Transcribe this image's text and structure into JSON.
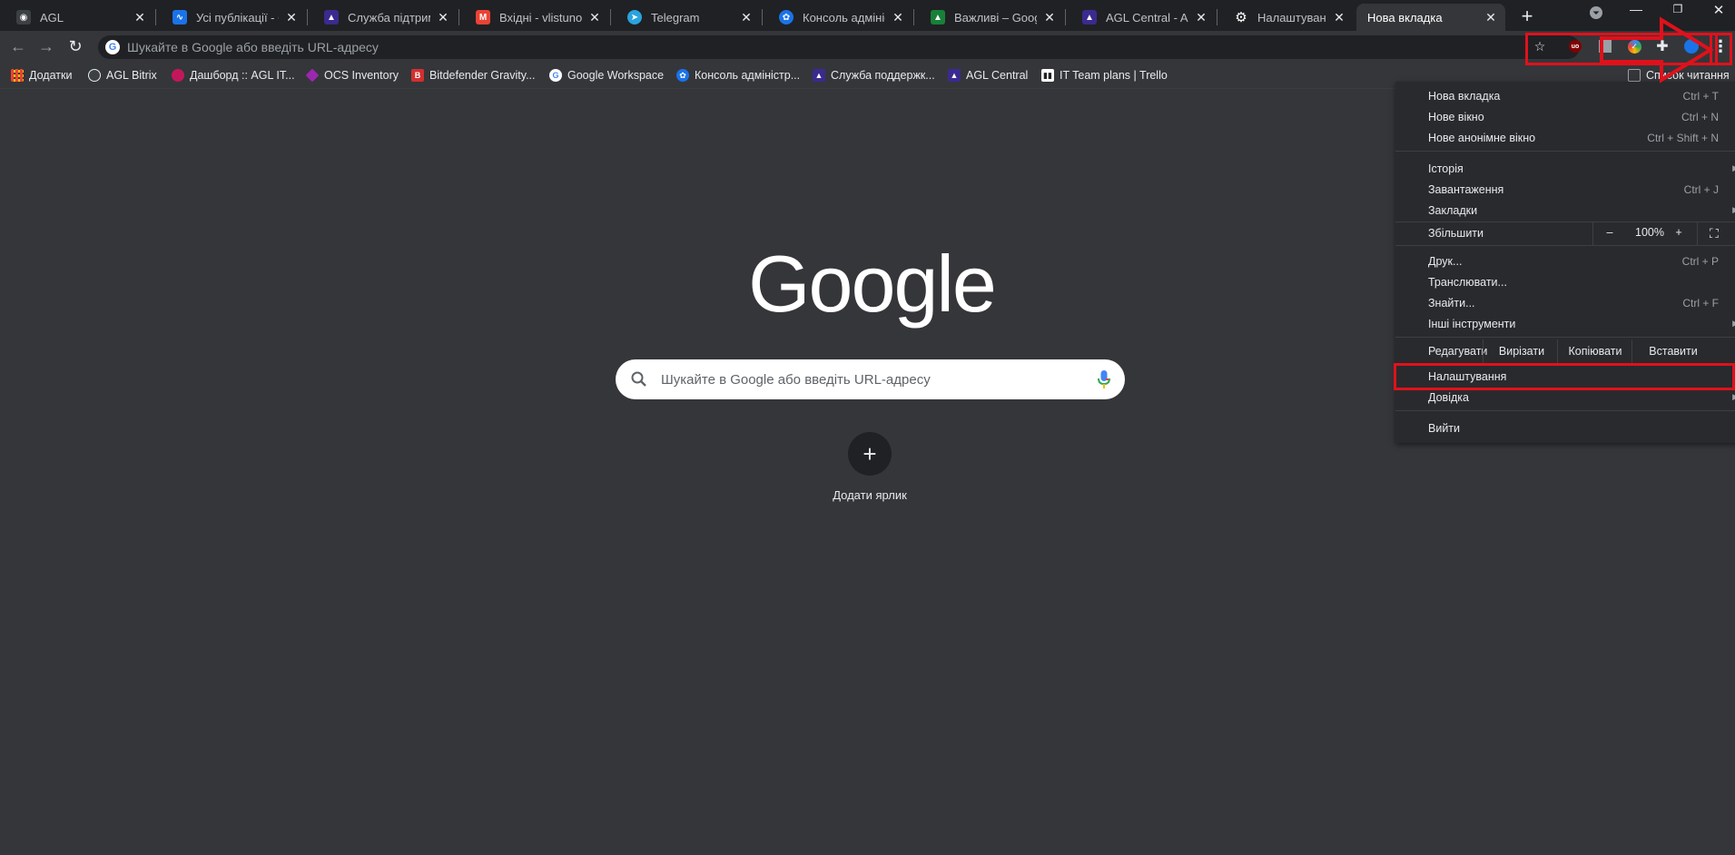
{
  "tabs": [
    {
      "title": "AGL",
      "color": "#3c4043",
      "glyph": "◉"
    },
    {
      "title": "Усі публікації - Cu",
      "color": "#1a73e8",
      "glyph": "∿"
    },
    {
      "title": "Служба підтримки",
      "color": "#3b2a8f",
      "glyph": "▲"
    },
    {
      "title": "Вхідні - vlistunov@",
      "color": "#ea4335",
      "glyph": "M"
    },
    {
      "title": "Telegram",
      "color": "#2aa3df",
      "glyph": "➤"
    },
    {
      "title": "Консоль адміністр",
      "color": "#1a73e8",
      "glyph": "✿"
    },
    {
      "title": "Важливі – Google",
      "color": "#188038",
      "glyph": "▲"
    },
    {
      "title": "AGL Central - AGL",
      "color": "#3b2a8f",
      "glyph": "▲"
    },
    {
      "title": "Налаштування",
      "color": "#5f6368",
      "glyph": "⚙"
    },
    {
      "title": "Нова вкладка",
      "color": "#35363a",
      "glyph": ""
    }
  ],
  "toolbar": {
    "omnibox_placeholder": "Шукайте в Google або введіть URL-адресу"
  },
  "bookmarks": [
    {
      "label": "Додатки",
      "color": "#e8710a"
    },
    {
      "label": "AGL Bitrix",
      "color": "#3c4043"
    },
    {
      "label": "Дашборд :: AGL IT...",
      "color": "#c2185b"
    },
    {
      "label": "OCS Inventory",
      "color": "#9c27b0"
    },
    {
      "label": "Bitdefender Gravity...",
      "color": "#d32f2f"
    },
    {
      "label": "Google Workspace",
      "color": "#ffffff"
    },
    {
      "label": "Консоль адміністр...",
      "color": "#1a73e8"
    },
    {
      "label": "Служба поддержк...",
      "color": "#3b2a8f"
    },
    {
      "label": "AGL Central",
      "color": "#3b2a8f"
    },
    {
      "label": "IT Team plans | Trello",
      "color": "#202124"
    }
  ],
  "reading_list": "Список читання",
  "page": {
    "logo": "Google",
    "search_placeholder": "Шукайте в Google або введіть URL-адресу",
    "add_shortcut_label": "Додати ярлик"
  },
  "menu": {
    "new_tab": "Нова вкладка",
    "new_tab_sc": "Ctrl + T",
    "new_window": "Нове вікно",
    "new_window_sc": "Ctrl + N",
    "incognito": "Нове анонімне вікно",
    "incognito_sc": "Ctrl + Shift + N",
    "history": "Історія",
    "downloads": "Завантаження",
    "downloads_sc": "Ctrl + J",
    "bookmarks": "Закладки",
    "zoom_label": "Збільшити",
    "zoom_minus": "–",
    "zoom_value": "100%",
    "zoom_plus": "+",
    "print": "Друк...",
    "print_sc": "Ctrl + P",
    "cast": "Транслювати...",
    "find": "Знайти...",
    "find_sc": "Ctrl + F",
    "more_tools": "Інші інструменти",
    "edit_label": "Редагувати",
    "cut": "Вирізати",
    "copy": "Копіювати",
    "paste": "Вставити",
    "settings": "Налаштування",
    "help": "Довідка",
    "exit": "Вийти"
  },
  "colors": {
    "annotation_red": "#e0111b",
    "page_bg": "#35363a",
    "tabstrip_bg": "#202124",
    "menu_bg": "#292a2d"
  }
}
